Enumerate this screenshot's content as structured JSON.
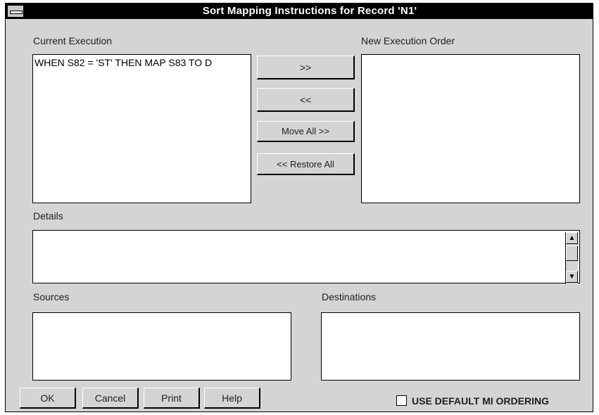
{
  "window": {
    "title": "Sort Mapping Instructions for Record 'N1'"
  },
  "current_execution": {
    "label": "Current Execution",
    "items": [
      "WHEN S82 = 'ST' THEN MAP S83 TO D"
    ]
  },
  "new_execution": {
    "label": "New Execution Order"
  },
  "move_buttons": {
    "add": ">>",
    "remove": "<<",
    "move_all": "Move All >>",
    "restore_all": "<< Restore All"
  },
  "details": {
    "label": "Details"
  },
  "sources": {
    "label": "Sources"
  },
  "destinations": {
    "label": "Destinations"
  },
  "footer": {
    "ok": "OK",
    "cancel": "Cancel",
    "print": "Print",
    "help": "Help",
    "default_ordering": "USE DEFAULT MI ORDERING"
  },
  "icons": {
    "system_menu": "system-menu-icon",
    "scroll_up": "▲",
    "scroll_down": "▼"
  }
}
